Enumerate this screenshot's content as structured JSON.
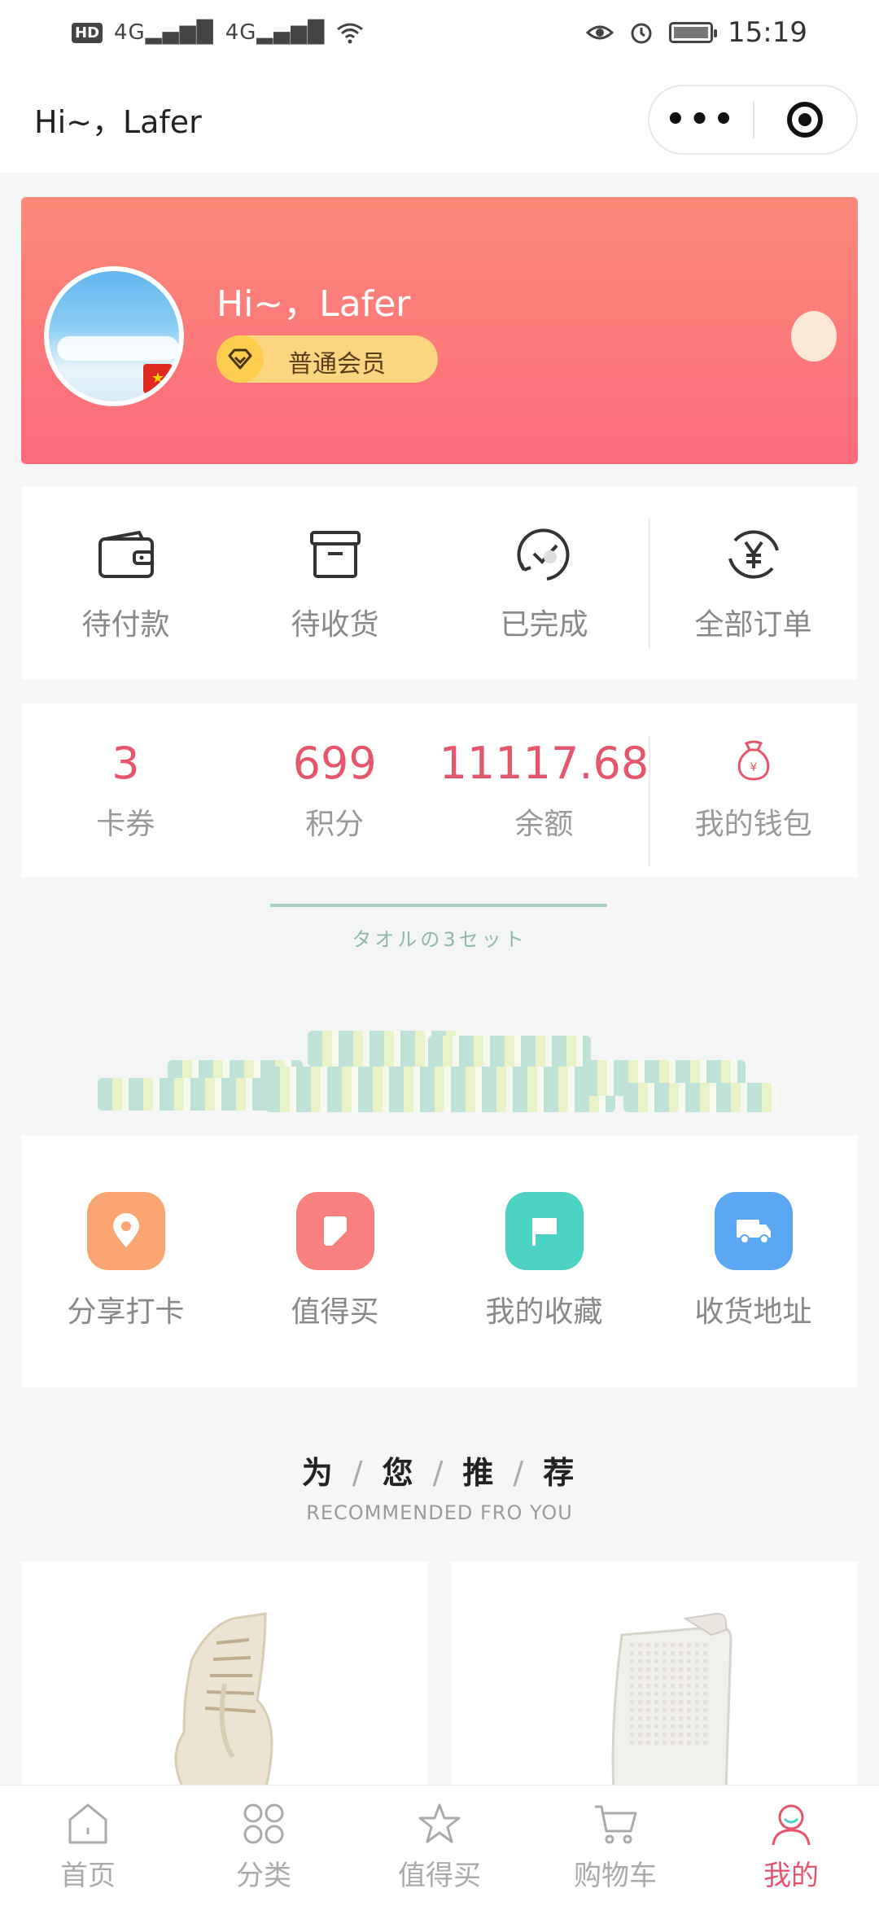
{
  "status_bar": {
    "network_left": "HD",
    "sim1": "4G",
    "sim2": "4G",
    "time": "15:19"
  },
  "nav": {
    "title": "Hi~，Lafer",
    "more_icon": "more-dots-icon",
    "close_icon": "target-icon"
  },
  "profile": {
    "greeting": "Hi~，Lafer",
    "member_level": "普通会员",
    "colors": {
      "gradient_top": "#fb8a78",
      "gradient_bottom": "#fd6b7c"
    }
  },
  "orders": [
    {
      "label": "待付款",
      "icon": "wallet-icon"
    },
    {
      "label": "待收货",
      "icon": "box-icon"
    },
    {
      "label": "已完成",
      "icon": "check-circle-icon"
    },
    {
      "label": "全部订单",
      "icon": "yen-circle-icon"
    }
  ],
  "wallet": [
    {
      "value": "3",
      "label": "卡券"
    },
    {
      "value": "699",
      "label": "积分"
    },
    {
      "value": "11117.68",
      "label": "余额"
    },
    {
      "label": "我的钱包",
      "icon": "money-bag-icon"
    }
  ],
  "banner": {
    "caption": "タオルの3セット"
  },
  "tools": [
    {
      "label": "分享打卡",
      "icon": "location-pin-icon",
      "color": "#fba572"
    },
    {
      "label": "值得买",
      "icon": "bookmark-icon",
      "color": "#f7807c"
    },
    {
      "label": "我的收藏",
      "icon": "flag-icon",
      "color": "#4cd1c2"
    },
    {
      "label": "收货地址",
      "icon": "truck-icon",
      "color": "#5aa6f0"
    }
  ],
  "recommend": {
    "title_chars": [
      "为",
      "您",
      "推",
      "荐"
    ],
    "subtitle": "RECOMMENDED FRO YOU"
  },
  "tabbar": [
    {
      "label": "首页",
      "icon": "home-icon",
      "active": false
    },
    {
      "label": "分类",
      "icon": "category-icon",
      "active": false
    },
    {
      "label": "值得买",
      "icon": "star-icon",
      "active": false
    },
    {
      "label": "购物车",
      "icon": "cart-icon",
      "active": false
    },
    {
      "label": "我的",
      "icon": "user-icon",
      "active": true
    }
  ],
  "accent_color": "#e5566d"
}
